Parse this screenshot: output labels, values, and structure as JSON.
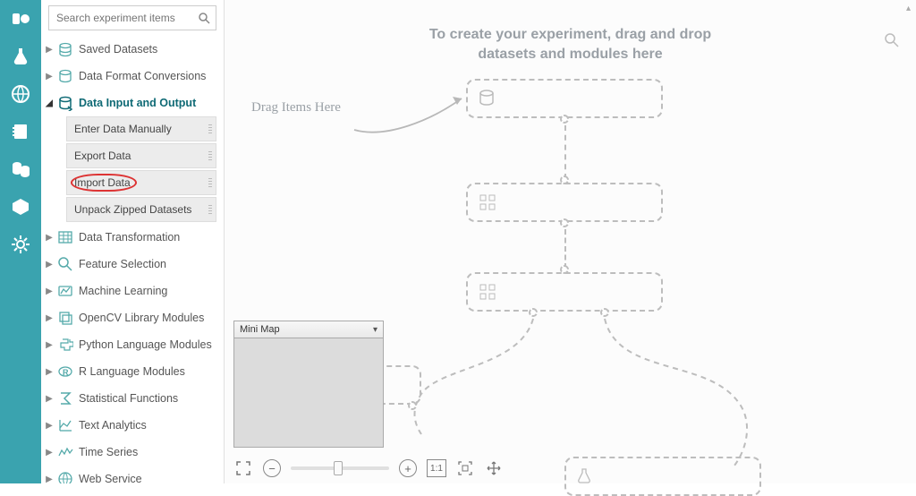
{
  "search": {
    "placeholder": "Search experiment items"
  },
  "rail": {
    "items": [
      "shapes",
      "flask",
      "globe",
      "notebook",
      "storage",
      "package",
      "gear"
    ]
  },
  "palette": {
    "categories": [
      {
        "label": "Saved Datasets",
        "expanded": false
      },
      {
        "label": "Data Format Conversions",
        "expanded": false
      },
      {
        "label": "Data Input and Output",
        "expanded": true,
        "selected": true,
        "children": [
          {
            "label": "Enter Data Manually"
          },
          {
            "label": "Export Data"
          },
          {
            "label": "Import Data",
            "highlighted": true
          },
          {
            "label": "Unpack Zipped Datasets"
          }
        ]
      },
      {
        "label": "Data Transformation"
      },
      {
        "label": "Feature Selection"
      },
      {
        "label": "Machine Learning"
      },
      {
        "label": "OpenCV Library Modules"
      },
      {
        "label": "Python Language Modules"
      },
      {
        "label": "R Language Modules"
      },
      {
        "label": "Statistical Functions"
      },
      {
        "label": "Text Analytics"
      },
      {
        "label": "Time Series"
      },
      {
        "label": "Web Service"
      }
    ]
  },
  "canvas": {
    "hint_line1": "To create your experiment, drag and drop",
    "hint_line2": "datasets and modules here",
    "drag_hint": "Drag Items Here",
    "minimap_title": "Mini Map"
  },
  "toolbar": {
    "zoom_actual_label": "1:1"
  },
  "colors": {
    "accent": "#3aa3af"
  }
}
